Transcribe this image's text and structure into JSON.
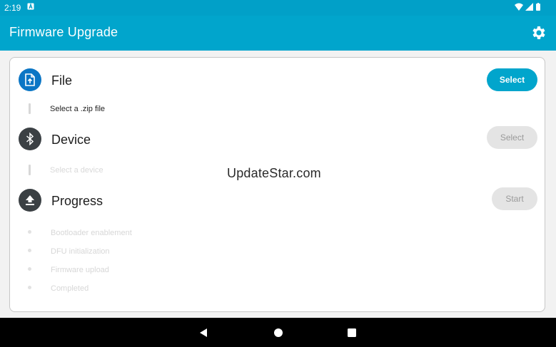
{
  "status_bar": {
    "time": "2:19",
    "notification_icon": "a-box-icon",
    "icons": [
      "wifi-icon",
      "signal-icon",
      "battery-icon"
    ]
  },
  "app_bar": {
    "title": "Firmware Upgrade",
    "action_icon": "gear-icon"
  },
  "file_section": {
    "title": "File",
    "button_label": "Select",
    "subtitle": "Select a .zip file",
    "icon": "file-upload-icon"
  },
  "device_section": {
    "title": "Device",
    "button_label": "Select",
    "subtitle": "Select a device",
    "icon": "bluetooth-icon"
  },
  "progress_section": {
    "title": "Progress",
    "button_label": "Start",
    "icon": "upload-icon",
    "steps": [
      "Bootloader enablement",
      "DFU initialization",
      "Firmware upload",
      "Completed"
    ]
  },
  "watermark": "UpdateStar.com",
  "nav_bar": {
    "icons": [
      "back-icon",
      "home-icon",
      "recents-icon"
    ]
  },
  "colors": {
    "accent": "#01a5cc",
    "file_icon_bg": "#0b76c5",
    "dark_icon_bg": "#3b4044",
    "disabled": "#e4e4e4"
  }
}
